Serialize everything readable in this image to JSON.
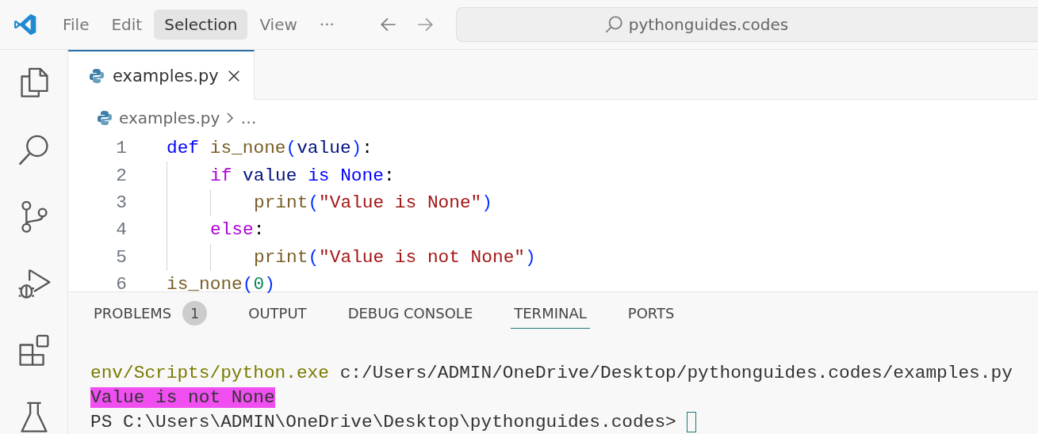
{
  "menu": [
    {
      "label": "File",
      "selected": false
    },
    {
      "label": "Edit",
      "selected": false
    },
    {
      "label": "Selection",
      "selected": true
    },
    {
      "label": "View",
      "selected": false
    },
    {
      "label": "···",
      "selected": false
    }
  ],
  "search": {
    "value": "pythonguides.codes"
  },
  "activity_bar": [
    {
      "kind": "files"
    },
    {
      "kind": "search"
    },
    {
      "kind": "source-control"
    },
    {
      "kind": "run-debug"
    },
    {
      "kind": "extensions"
    },
    {
      "kind": "testing"
    }
  ],
  "editor_tabs": [
    {
      "label": "examples.py",
      "selected": true
    }
  ],
  "breadcrumb": {
    "file": "examples.py",
    "more": "…"
  },
  "code": [
    {
      "number": "1",
      "tokens": [
        {
          "kind": "keyword",
          "text": "def "
        },
        {
          "kind": "function",
          "text": "is_none"
        },
        {
          "kind": "bracket",
          "text": "("
        },
        {
          "kind": "variable",
          "text": "value"
        },
        {
          "kind": "bracket",
          "text": ")"
        },
        {
          "kind": "plain",
          "text": ":"
        }
      ],
      "children": [
        {
          "number": "2",
          "tokens": [
            {
              "kind": "control",
              "text": "if "
            },
            {
              "kind": "variable",
              "text": "value "
            },
            {
              "kind": "keyword",
              "text": "is None"
            },
            {
              "kind": "plain",
              "text": ":"
            }
          ],
          "children": [
            {
              "number": "3",
              "tokens": [
                {
                  "kind": "function",
                  "text": "print"
                },
                {
                  "kind": "bracket",
                  "text": "("
                },
                {
                  "kind": "string",
                  "text": "\"Value is None\""
                },
                {
                  "kind": "bracket",
                  "text": ")"
                }
              ]
            }
          ]
        },
        {
          "number": "4",
          "tokens": [
            {
              "kind": "control",
              "text": "else"
            },
            {
              "kind": "plain",
              "text": ":"
            }
          ],
          "children": [
            {
              "number": "5",
              "tokens": [
                {
                  "kind": "function",
                  "text": "print"
                },
                {
                  "kind": "bracket",
                  "text": "("
                },
                {
                  "kind": "string",
                  "text": "\"Value is not None\""
                },
                {
                  "kind": "bracket",
                  "text": ")"
                }
              ]
            }
          ]
        }
      ]
    },
    {
      "number": "6",
      "tokens": [
        {
          "kind": "function",
          "text": "is_none"
        },
        {
          "kind": "bracket",
          "text": "("
        },
        {
          "kind": "number",
          "text": "0"
        },
        {
          "kind": "bracket",
          "text": ")"
        }
      ]
    }
  ],
  "panel_tabs": [
    {
      "label": "PROBLEMS",
      "badge": "1",
      "selected": false
    },
    {
      "label": "OUTPUT",
      "selected": false
    },
    {
      "label": "DEBUG CONSOLE",
      "selected": false
    },
    {
      "label": "TERMINAL",
      "selected": true
    },
    {
      "label": "PORTS",
      "selected": false
    }
  ],
  "terminal": [
    {
      "parts": [
        {
          "kind": "exe",
          "text": "env/Scripts/python.exe"
        },
        {
          "kind": "arg",
          "text": " c:/Users/ADMIN/OneDrive/Desktop/pythonguides.codes/examples.py"
        }
      ]
    },
    {
      "highlighted": true,
      "parts": [
        {
          "kind": "arg",
          "text": "Value is not None"
        }
      ]
    },
    {
      "cursor": true,
      "parts": [
        {
          "kind": "arg",
          "text": "PS C:\\Users\\ADMIN\\OneDrive\\Desktop\\pythonguides.codes> "
        }
      ]
    }
  ]
}
